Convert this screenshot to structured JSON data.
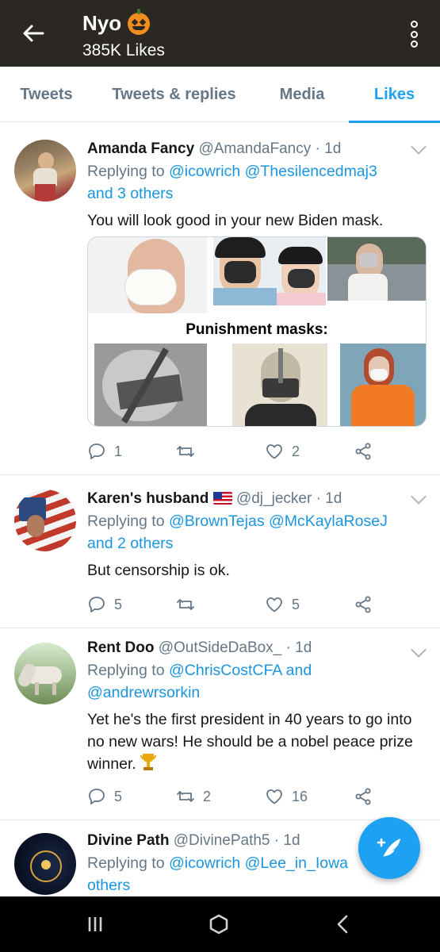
{
  "header": {
    "title": "Nyo",
    "subtitle": "385K Likes",
    "back_icon": "arrow-left-icon",
    "menu_icon": "more-vertical-icon",
    "emoji_icon": "jack-o-lantern-icon"
  },
  "tabs": [
    {
      "label": "Tweets",
      "active": false
    },
    {
      "label": "Tweets & replies",
      "active": false
    },
    {
      "label": "Media",
      "active": false
    },
    {
      "label": "Likes",
      "active": true
    }
  ],
  "tweets": [
    {
      "name": "Amanda Fancy",
      "handle": "@AmandaFancy",
      "time": "· 1d",
      "reply_prefix": "Replying to",
      "reply_mentions": "@icowrich @Thesilencedmaj3",
      "reply_suffix": "and 3 others",
      "text": "You will look good in your new Biden mask.",
      "media_caption": "Punishment masks:",
      "replies": "1",
      "retweets": "",
      "likes": "2"
    },
    {
      "name": "Karen's husband",
      "flag": "us-flag-icon",
      "handle": "@dj_jecker",
      "time": "· 1d",
      "reply_prefix": "Replying to",
      "reply_mentions": "@BrownTejas @McKaylaRoseJ",
      "reply_suffix": "and 2 others",
      "text": "But censorship is ok.",
      "replies": "5",
      "retweets": "",
      "likes": "5"
    },
    {
      "name": "Rent Doo",
      "handle": "@OutSideDaBox_",
      "time": "· 1d",
      "reply_prefix": "Replying to",
      "reply_mentions": "@ChrisCostCFA and",
      "reply_suffix": "@andrewrsorkin",
      "text": "Yet he's the first president in 40 years to go into no new wars!  He should be a nobel peace prize winner.",
      "trophy_icon": "trophy-icon",
      "replies": "5",
      "retweets": "2",
      "likes": "16"
    },
    {
      "name": "Divine Path",
      "handle": "@DivinePath5",
      "time": "· 1d",
      "reply_prefix": "Replying to",
      "reply_mentions": "@icowrich @Lee_in_Iowa",
      "reply_suffix": "others"
    }
  ],
  "fab": {
    "icon": "compose-tweet-icon"
  },
  "navbar": {
    "recents_icon": "recents-icon",
    "home_icon": "home-icon",
    "back_icon": "nav-back-icon"
  },
  "colors": {
    "accent": "#1da1f2",
    "header_bg": "#2b2722",
    "muted": "#657786",
    "link": "#1b95e0"
  }
}
